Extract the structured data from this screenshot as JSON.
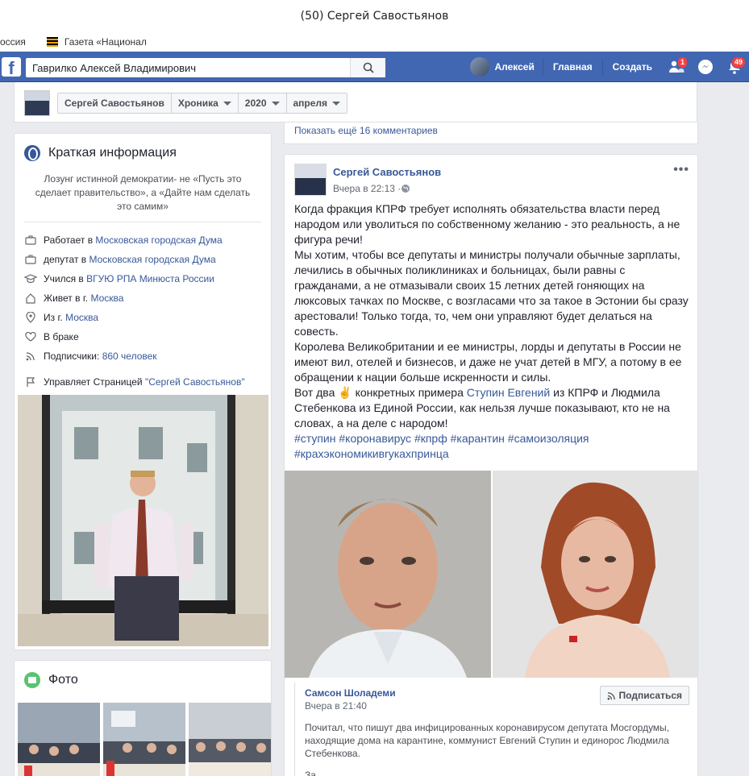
{
  "window": {
    "title": "(50) Сергей Савостьянов"
  },
  "bookmarks": [
    {
      "label": "оссия"
    },
    {
      "label": "Газета «Национал"
    }
  ],
  "topbar": {
    "logo": "f",
    "search_value": "Гаврилко Алексей Владимирович",
    "user_name": "Алексей",
    "home": "Главная",
    "create": "Создать",
    "friend_requests_badge": "1",
    "notifications_badge": "49"
  },
  "timeline_nav": {
    "name": "Сергей Савостьянов",
    "section": "Хроника",
    "year": "2020",
    "month": "апреля"
  },
  "intro": {
    "title": "Краткая информация",
    "motto": "Лозунг истинной демократии- не «Пусть это сделает правительство», а «Дайте нам сделать это самим»",
    "work1": {
      "prefix": "Работает в ",
      "link": "Московская городская Дума"
    },
    "work2": {
      "prefix": "депутат в ",
      "link": "Московская городская Дума"
    },
    "edu": {
      "prefix": "Учился в ",
      "link": "ВГУЮ РПА Минюста России"
    },
    "lives": {
      "prefix": "Живет в г. ",
      "link": "Москва"
    },
    "from": {
      "prefix": "Из г. ",
      "link": "Москва"
    },
    "relationship": "В браке",
    "followers": {
      "prefix": "Подписчики: ",
      "link": "860 человек"
    },
    "manages": {
      "prefix": "Управляет Страницей ",
      "link": "\"Сергей Савостьянов\""
    }
  },
  "photos": {
    "title": "Фото"
  },
  "comments": {
    "more": "Показать ещё 16 комментариев"
  },
  "post": {
    "author": "Сергей Савостьянов",
    "time": "Вчера в 22:13 · ",
    "more": "•••",
    "p1": "Когда фракция КПРФ требует исполнять обязательства власти перед народом или уволиться по собственному желанию - это реальность, а не фигура речи!",
    "p2": "Мы хотим, чтобы все депутаты и министры получали обычные зарплаты, лечились в обычных поликлиниках и больницах, были равны с гражданами, а не отмазывали своих 15 летних детей гоняющих на люксовых тачках по Москве, с возгласами что за такое в Эстонии бы сразу арестовали! Только тогда, то, чем они управляют будет делаться на совесть.",
    "p3": "Королева Великобритании и ее министры, лорды и депутаты в России не имеют вил, отелей и бизнесов, и даже не учат детей в МГУ, а потому в ее обращении к нации больше искренности и силы.",
    "p4_a": "Вот два ✌ конкретных примера ",
    "p4_link": "Ступин Евгений",
    "p4_b": " из КПРФ и Людмила Стебенкова из Единой России, как нельзя лучше показывают, кто не на словах, а на деле с народом!",
    "hashtags1": "#ступин #коронавирус #кпрф #карантин #самоизоляция",
    "hashtags2": "#крахэкономикивrукахпринца",
    "shared": {
      "author": "Самсон Шоладеми",
      "time": "Вчера в 21:40",
      "follow": "Подписаться",
      "text": "Почитал, что пишут два инфицированных коронавирусом депутата Мосгордумы, находящие дома на карантине, коммунист Евгений Ступин и единорос Людмила Стебенкова.",
      "cut": "За"
    }
  }
}
